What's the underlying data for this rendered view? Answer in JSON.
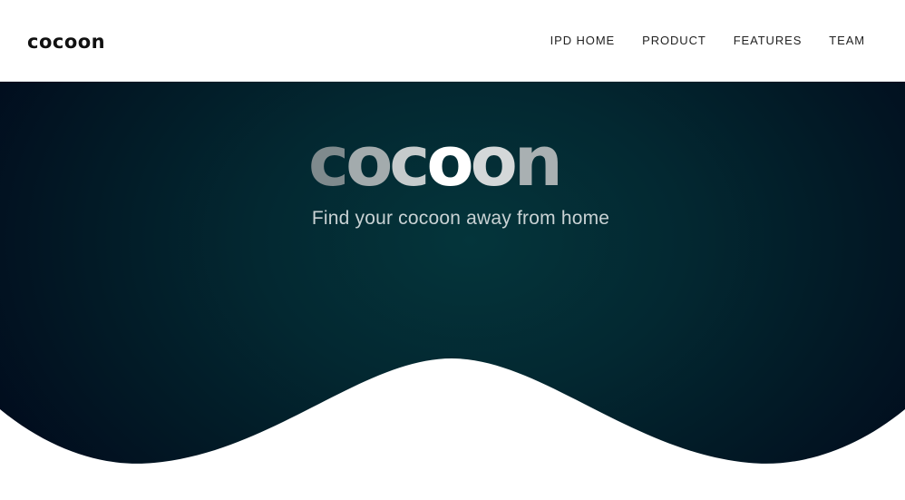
{
  "nav": {
    "brand": "cocoon",
    "links": [
      {
        "label": "IPD HOME"
      },
      {
        "label": "PRODUCT"
      },
      {
        "label": "FEATURES"
      },
      {
        "label": "TEAM"
      }
    ]
  },
  "hero": {
    "logo_letters": [
      {
        "char": "c",
        "color": "#7f8a8d"
      },
      {
        "char": "o",
        "color": "#a3abad"
      },
      {
        "char": "c",
        "color": "#c6cbcc"
      },
      {
        "char": "o",
        "color": "#ffffff"
      },
      {
        "char": "o",
        "color": "#d4d8d9"
      },
      {
        "char": "n",
        "color": "#a9b0b2"
      }
    ],
    "tagline": "Find your cocoon away from home"
  },
  "colors": {
    "hero_center": "#04353b",
    "hero_edge": "#010a1c",
    "background": "#ffffff"
  }
}
